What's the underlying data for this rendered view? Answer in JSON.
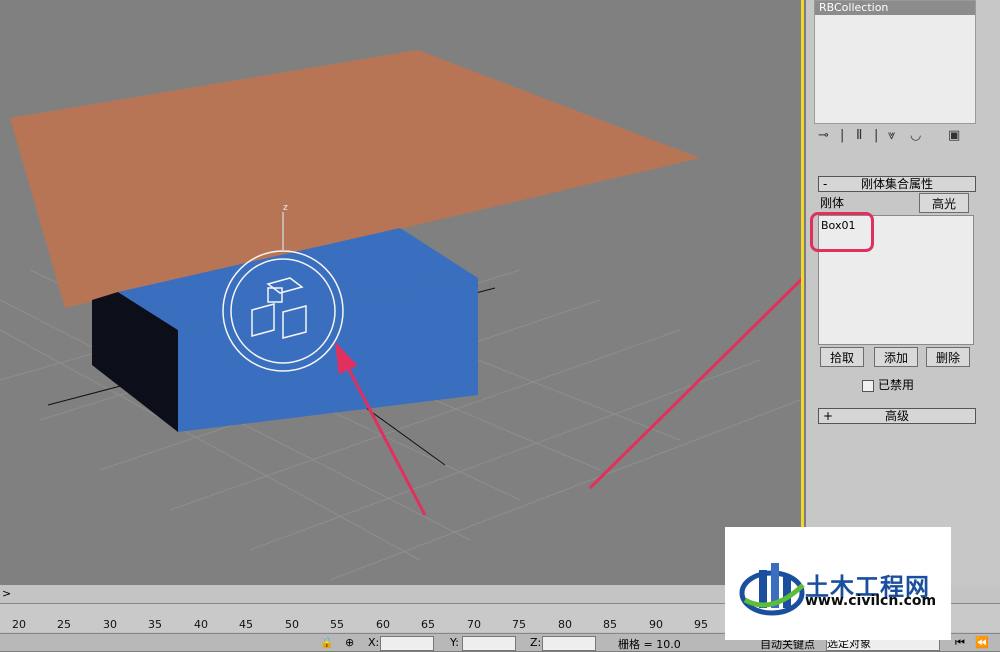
{
  "top_list": {
    "selected_item": "RBCollection"
  },
  "toolbar_icons": [
    "pin-icon",
    "separator",
    "tuning-fork-icon",
    "separator",
    "hierarchy-icon",
    "lock-icon",
    "configure-icon"
  ],
  "rollout_properties": {
    "toggle": "-",
    "title": "刚体集合属性",
    "list_label": "刚体",
    "highlight_button": "高光",
    "items": [
      "Box01"
    ],
    "pick_button": "拾取",
    "add_button": "添加",
    "delete_button": "删除",
    "disabled_checkbox_label": "已禁用",
    "disabled_checked": false
  },
  "rollout_advanced": {
    "toggle": "+",
    "title": "高级"
  },
  "timeline": {
    "slider_arrow": ">",
    "ticks": [
      "20",
      "25",
      "30",
      "35",
      "40",
      "45",
      "50",
      "55",
      "60",
      "65",
      "70",
      "75",
      "80",
      "85",
      "90",
      "95"
    ]
  },
  "status_bar": {
    "x_label": "X:",
    "y_label": "Y:",
    "z_label": "Z:",
    "grid_text": "栅格 = 10.0",
    "auto_key_text": "自动关键点",
    "selection_dropdown": "选定对象"
  },
  "viewport": {
    "axis_label": "z"
  },
  "watermark": {
    "name": "土木工程网",
    "url": "www.civilcn.com"
  },
  "colors": {
    "plane": "#b87555",
    "box_front": "#3a6fbf",
    "box_top": "#3a6ebf",
    "box_dark": "#0c0f1a",
    "annotation": "#e0305e",
    "viewport_border": "#f2d630"
  }
}
